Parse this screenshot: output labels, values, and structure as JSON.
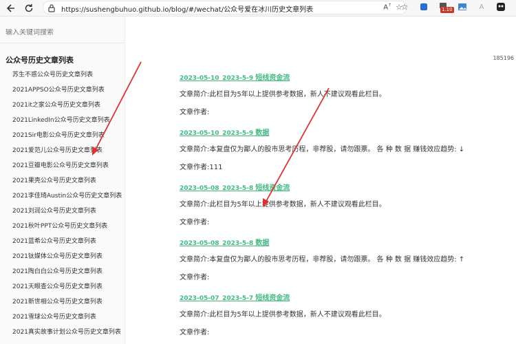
{
  "browser": {
    "url": "https://sushengbuhuo.github.io/blog/#/wechat/公众号爱在冰川历史文章列表",
    "badge": "1.10"
  },
  "sidebar": {
    "search_placeholder": "输入关键词搜索",
    "title": "公众号历史文章列表",
    "items": [
      "苏生不惑公众号历史文章列表",
      "2021APPSO公众号历史文章列表",
      "2021it之家公众号历史文章列表",
      "2021LinkedIn公众号历史文章列表",
      "2021Sir电影公众号历史文章列表",
      "2021爱范儿公众号历史文章列表",
      "2021豆瓣电影公众号历史文章列表",
      "2021果壳公众号历史文章列表",
      "2021李佳琦Austin公众号历史文章列表",
      "2021刘润公众号历史文章列表",
      "2021秋叶PPT公众号历史文章列表",
      "2021蓝希公众号历史文章列表",
      "2021钛媒体公众号历史文章列表",
      "2021陶白白公众号历史文章列表",
      "2021天眼查公众号历史文章列表",
      "2021新世相公众号历史文章列表",
      "2021雪球公众号历史文章列表",
      "2021真实故事计划公众号历史文章列表"
    ]
  },
  "main": {
    "counter": "185196",
    "articles": [
      {
        "date": "2023-05-10_2023-5-9 ",
        "tag": "短线资金流",
        "summary": "文章简介:此栏目为5年以上提供参考数据，新人不建议观看此栏目。",
        "author": "文章作者:"
      },
      {
        "date": "2023-05-10_2023-5-9 ",
        "tag": "数据",
        "summary": "文章简介:本复盘仅为鄙人的股市思考历程，非荐股，请勿跟票。 各 种 数 据 赚钱效应趋势: ↓",
        "author": "文章作者:111"
      },
      {
        "date": "2023-05-08_2023-5-8 ",
        "tag": "短线资金流",
        "summary": "文章简介:此栏目为5年以上提供参考数据，新人不建议观看此栏目。",
        "author": "文章作者:"
      },
      {
        "date": "2023-05-08_2023-5-8 ",
        "tag": "数据",
        "summary": "文章简介:本复盘仅为鄙人的股市思考历程，非荐股，请勿跟票。 各 种 数 据 赚钱效应趋势: ↑",
        "author": "文章作者:"
      },
      {
        "date": "2023-05-07_2023-5-7 ",
        "tag": "短线资金流",
        "summary": "文章简介:此栏目为5年以上提供参考数据，新人不建议观看此栏目。",
        "author": "文章作者:"
      }
    ]
  }
}
